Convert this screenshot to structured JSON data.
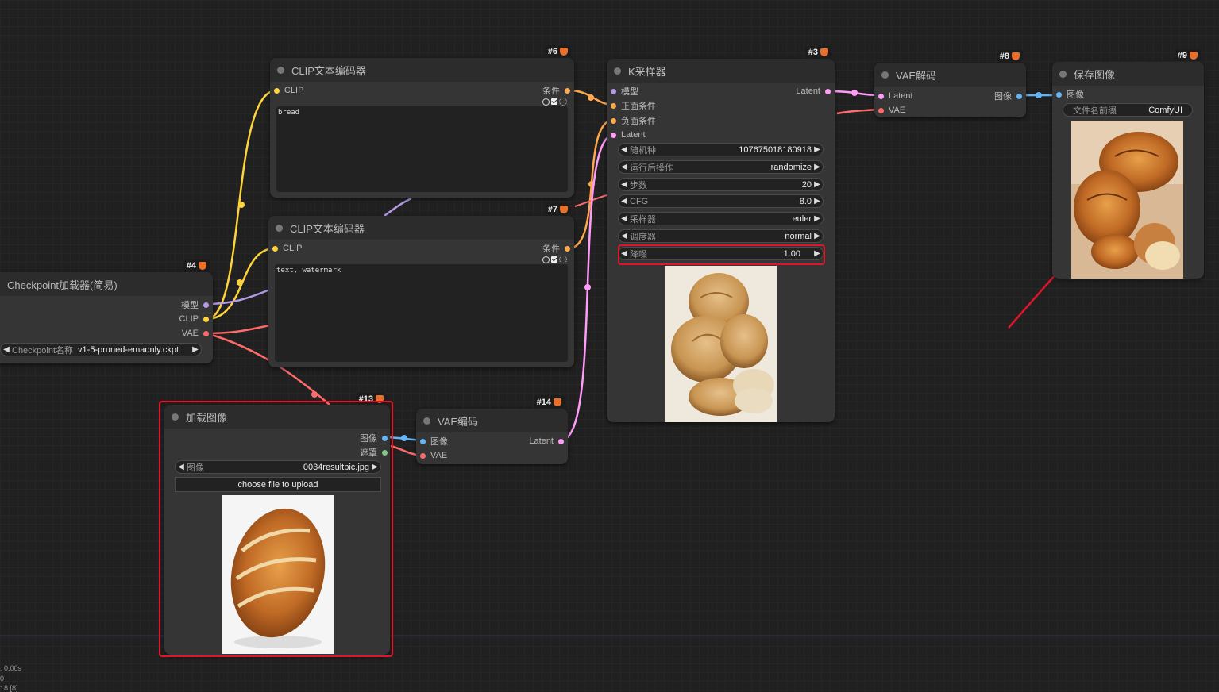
{
  "colors": {
    "model": "#b49ae6",
    "clip": "#ffd43b",
    "vae": "#ff6b6b",
    "condition": "#ffa94d",
    "latent": "#ff9cf9",
    "image": "#64b5f6",
    "mask": "#81c784",
    "highlight": "#e0142a"
  },
  "nodes": {
    "checkpoint": {
      "badge": "#4",
      "title": "Checkpoint加载器(简易)",
      "outputs": [
        "模型",
        "CLIP",
        "VAE"
      ],
      "widget_label": "Checkpoint名称",
      "widget_value": "v1-5-pruned-emaonly.ckpt"
    },
    "clip_pos": {
      "badge": "#6",
      "title": "CLIP文本编码器",
      "input": "CLIP",
      "output": "条件",
      "text": "bread"
    },
    "clip_neg": {
      "badge": "#7",
      "title": "CLIP文本编码器",
      "input": "CLIP",
      "output": "条件",
      "text": "text, watermark"
    },
    "ksampler": {
      "badge": "#3",
      "title": "K采样器",
      "inputs": [
        "模型",
        "正面条件",
        "负面条件",
        "Latent"
      ],
      "output": "Latent",
      "widgets": [
        {
          "label": "随机种",
          "value": "107675018180918"
        },
        {
          "label": "运行后操作",
          "value": "randomize"
        },
        {
          "label": "步数",
          "value": "20"
        },
        {
          "label": "CFG",
          "value": "8.0"
        },
        {
          "label": "采样器",
          "value": "euler"
        },
        {
          "label": "调度器",
          "value": "normal"
        },
        {
          "label": "降噪",
          "value": "1.00"
        }
      ]
    },
    "vae_decode": {
      "badge": "#8",
      "title": "VAE解码",
      "inputs": [
        "Latent",
        "VAE"
      ],
      "output": "图像"
    },
    "save_image": {
      "badge": "#9",
      "title": "保存图像",
      "input": "图像",
      "widget_label": "文件名前缀",
      "widget_value": "ComfyUI"
    },
    "load_image": {
      "badge": "#13",
      "title": "加载图像",
      "outputs": [
        "图像",
        "遮罩"
      ],
      "widget_label": "图像",
      "widget_value": "0034resultpic.jpg",
      "upload_label": "choose file to upload"
    },
    "vae_encode": {
      "badge": "#14",
      "title": "VAE编码",
      "inputs": [
        "图像",
        "VAE"
      ],
      "output": "Latent"
    }
  },
  "status": [
    ": 0.00s",
    "0",
    ": 8 [8]"
  ]
}
